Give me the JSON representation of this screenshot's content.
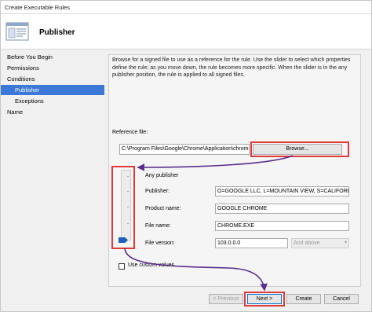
{
  "window": {
    "title": "Create Executable Rules"
  },
  "header": {
    "title": "Publisher",
    "icon": "rules-wizard-icon"
  },
  "nav": {
    "items": [
      {
        "label": "Before You Begin",
        "selected": false,
        "indent": false
      },
      {
        "label": "Permissions",
        "selected": false,
        "indent": false
      },
      {
        "label": "Conditions",
        "selected": false,
        "indent": false
      },
      {
        "label": "Publisher",
        "selected": true,
        "indent": true
      },
      {
        "label": "Exceptions",
        "selected": false,
        "indent": true
      },
      {
        "label": "Name",
        "selected": false,
        "indent": false
      }
    ]
  },
  "content": {
    "description": "Browse for a signed file to use as a reference for the rule. Use the slider to select which properties define the rule; as you move down, the rule becomes more specific. When the slider is in the any publisher position, the rule is applied to all signed files.",
    "reference_label": "Reference file:",
    "reference_value": "C:\\Program Files\\Google\\Chrome\\Application\\chrome.exe",
    "browse_label": "Browse...",
    "any_publisher": "Any publisher",
    "fields": {
      "publisher_label": "Publisher:",
      "publisher_value": "O=GOOGLE LLC, L=MOUNTAIN VIEW, S=CALIFORNIA, C=US",
      "product_label": "Product name:",
      "product_value": "GOOGLE CHROME",
      "file_label": "File name:",
      "file_value": "CHROME.EXE",
      "version_label": "File version:",
      "version_value": "103.0.0.0",
      "version_operator": "And above"
    },
    "custom_values_label": "Use custom values",
    "custom_values_checked": false
  },
  "footer": {
    "previous": "< Previous",
    "next": "Next >",
    "create": "Create",
    "cancel": "Cancel"
  },
  "colors": {
    "highlight": "#e03a3a",
    "arrow": "#5b2d8e",
    "selection": "#3b78d8",
    "slider_thumb": "#1f5fbf"
  }
}
